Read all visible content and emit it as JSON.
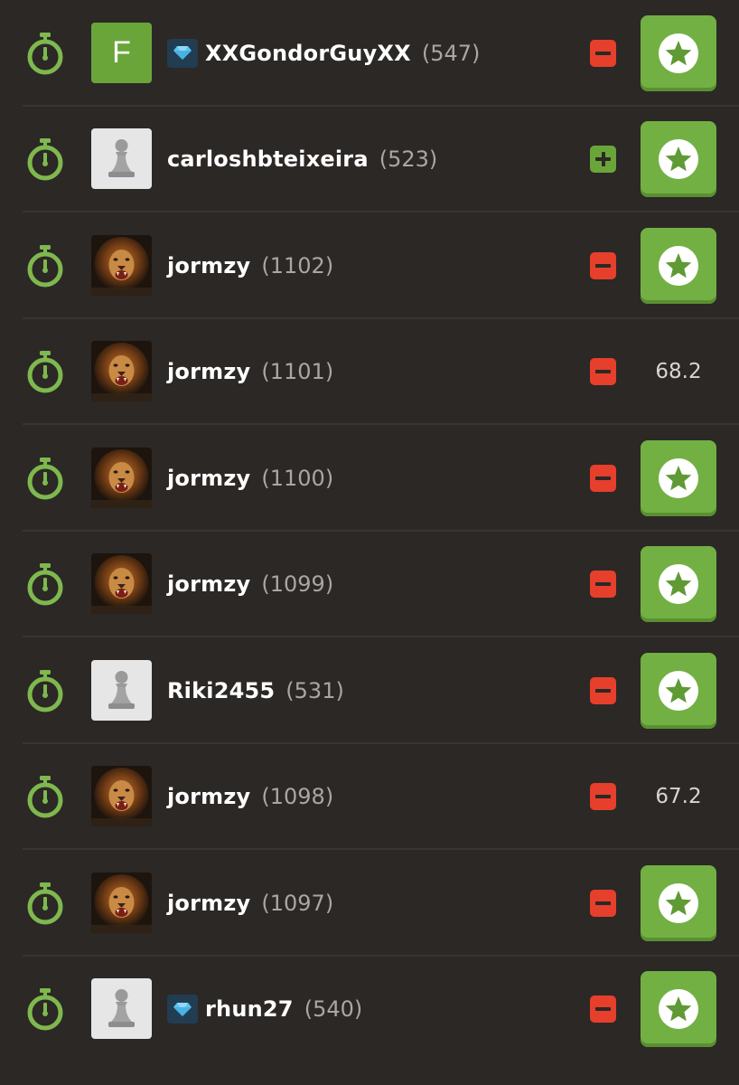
{
  "rows": [
    {
      "avatar": "letter",
      "avatar_letter": "F",
      "premium": true,
      "username": "XXGondorGuyXX",
      "rating": "(547)",
      "toggle": "remove",
      "action": "star"
    },
    {
      "avatar": "pawn",
      "premium": false,
      "username": "carloshbteixeira",
      "rating": "(523)",
      "toggle": "add",
      "action": "star"
    },
    {
      "avatar": "lion",
      "premium": false,
      "username": "jormzy",
      "rating": "(1102)",
      "toggle": "remove",
      "action": "star"
    },
    {
      "avatar": "lion",
      "premium": false,
      "username": "jormzy",
      "rating": "(1101)",
      "toggle": "remove",
      "action": "score",
      "score": "68.2"
    },
    {
      "avatar": "lion",
      "premium": false,
      "username": "jormzy",
      "rating": "(1100)",
      "toggle": "remove",
      "action": "star"
    },
    {
      "avatar": "lion",
      "premium": false,
      "username": "jormzy",
      "rating": "(1099)",
      "toggle": "remove",
      "action": "star"
    },
    {
      "avatar": "pawn",
      "premium": false,
      "username": "Riki2455",
      "rating": "(531)",
      "toggle": "remove",
      "action": "star"
    },
    {
      "avatar": "lion",
      "premium": false,
      "username": "jormzy",
      "rating": "(1098)",
      "toggle": "remove",
      "action": "score",
      "score": "67.2"
    },
    {
      "avatar": "lion",
      "premium": false,
      "username": "jormzy",
      "rating": "(1097)",
      "toggle": "remove",
      "action": "star"
    },
    {
      "avatar": "pawn",
      "premium": true,
      "username": "rhun27",
      "rating": "(540)",
      "toggle": "remove",
      "action": "star"
    }
  ],
  "icons": {
    "timer": "stopwatch-icon",
    "premium": "diamond-icon",
    "remove": "minus-icon",
    "add": "plus-icon",
    "challenge": "star-icon"
  },
  "colors": {
    "background": "#2b2826",
    "divider": "#383532",
    "accent_green": "#72b043",
    "timer_green": "#7fb84e",
    "remove_red": "#e63f2c",
    "add_green": "#6aa53a",
    "premium_badge_bg": "#223d52",
    "diamond": "#5fc3f0",
    "rating_gray": "#a9a6a3"
  }
}
